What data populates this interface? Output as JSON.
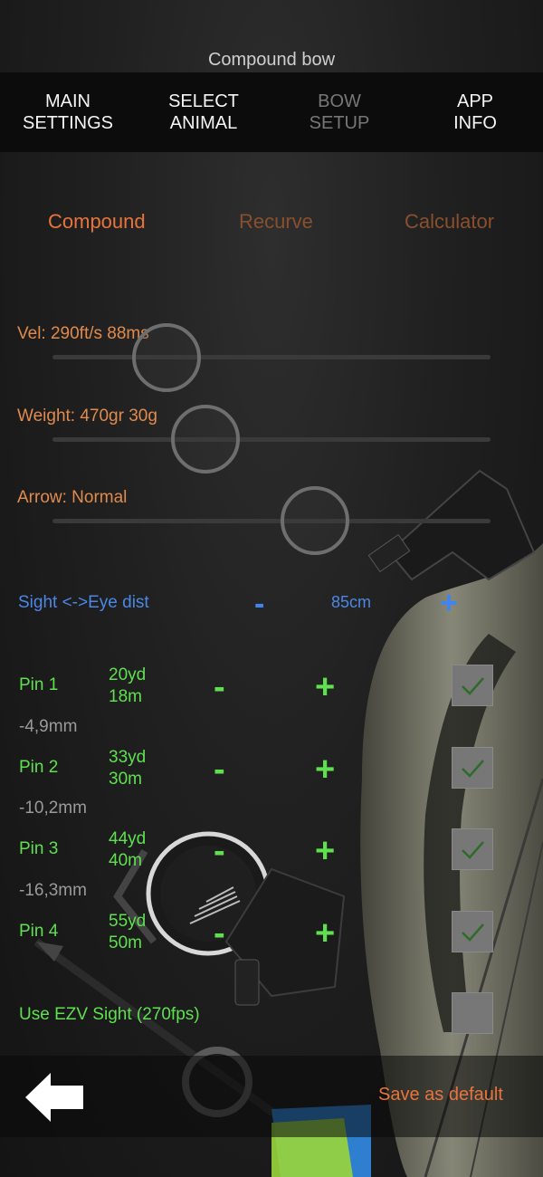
{
  "title": "Compound bow",
  "nav": [
    {
      "label": "MAIN\nSETTINGS",
      "active": false
    },
    {
      "label": "SELECT\nANIMAL",
      "active": false
    },
    {
      "label": "BOW\nSETUP",
      "active": true
    },
    {
      "label": "APP\nINFO",
      "active": false
    }
  ],
  "tabs": {
    "compound": "Compound",
    "recurve": "Recurve",
    "calculator": "Calculator",
    "active": "compound"
  },
  "sliders": {
    "velocity": {
      "label": "Vel: 290ft/s 88ms",
      "level": 0.26
    },
    "weight": {
      "label": "Weight: 470gr 30g",
      "level": 0.35
    },
    "arrow": {
      "label": "Arrow: Normal",
      "level": 0.6
    }
  },
  "sight_eye": {
    "label": "Sight <->Eye dist",
    "minus": "-",
    "value": "85cm",
    "plus": "+"
  },
  "pins": [
    {
      "label": "Pin 1",
      "yards": "20yd",
      "meters": "18m",
      "minus": "-",
      "plus": "+",
      "checked": true,
      "offset": "-4,9mm"
    },
    {
      "label": "Pin 2",
      "yards": "33yd",
      "meters": "30m",
      "minus": "-",
      "plus": "+",
      "checked": true,
      "offset": "-10,2mm"
    },
    {
      "label": "Pin 3",
      "yards": "44yd",
      "meters": "40m",
      "minus": "-",
      "plus": "+",
      "checked": true,
      "offset": "-16,3mm"
    },
    {
      "label": "Pin 4",
      "yards": "55yd",
      "meters": "50m",
      "minus": "-",
      "plus": "+",
      "checked": true
    }
  ],
  "ezv": {
    "label": "Use EZV Sight (270fps)",
    "checked": false
  },
  "footer": {
    "save_label": "Save as default",
    "back_icon": "back-arrow-icon"
  },
  "colors": {
    "accent_orange": "#e8743c",
    "inactive_orange": "#8a4f2c",
    "pin_green": "#5fe04f",
    "sight_blue": "#4b87e6"
  }
}
